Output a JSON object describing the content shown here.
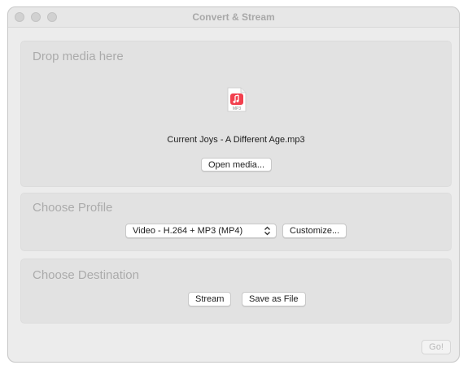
{
  "window": {
    "title": "Convert & Stream"
  },
  "drop_panel": {
    "heading": "Drop media here",
    "file_icon_label": "MP3",
    "file_icon": "music-note-icon",
    "file_name": "Current Joys - A Different Age.mp3",
    "open_button": "Open media..."
  },
  "profile_panel": {
    "heading": "Choose Profile",
    "selected_profile": "Video - H.264 + MP3 (MP4)",
    "customize_button": "Customize..."
  },
  "destination_panel": {
    "heading": "Choose Destination",
    "stream_button": "Stream",
    "save_button": "Save as File"
  },
  "footer": {
    "go_button": "Go!"
  },
  "colors": {
    "accent_red": "#f2404e",
    "heading_gray": "#ababab"
  }
}
